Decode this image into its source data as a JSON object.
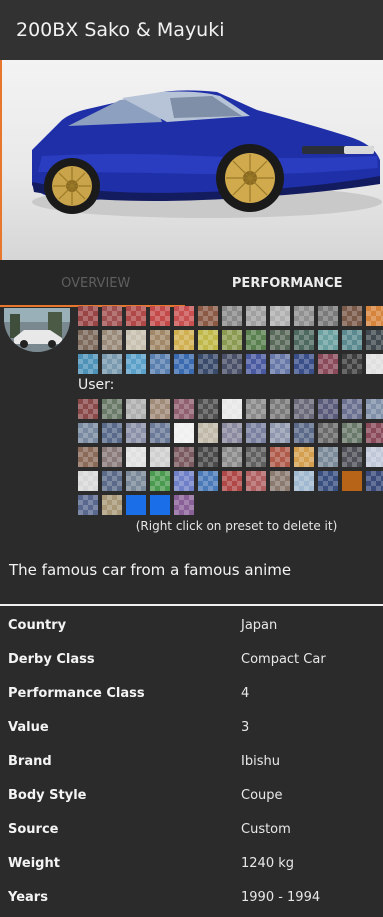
{
  "header": {
    "title": "200BX Sako & Mayuki"
  },
  "tabs": [
    {
      "label": "OVERVIEW",
      "active": false
    },
    {
      "label": "PERFORMANCE",
      "active": true
    }
  ],
  "accent": "#e8772e",
  "palette": {
    "preset_colors": [
      "#9a4545",
      "#a05050",
      "#b04848",
      "#c44a4a",
      "#c85050",
      "#8a5a45",
      "#8a8a8a",
      "#a0a0a0",
      "#b0b0b0",
      "#909090",
      "#7a7a7a",
      "#7a5a48",
      "#d6843c",
      "#7d6a5c",
      "#9a8a7a",
      "#c8c0b0",
      "#a08868",
      "#d0b050",
      "#c0b848",
      "#8a9a50",
      "#5a8050",
      "#5a6a5a",
      "#4e6a60",
      "#6aa0a0",
      "#5a8a90",
      "#404a50",
      "#4e92b8",
      "#7a9ab0",
      "#5aa0c8",
      "#5a80b0",
      "#3a6ab0",
      "#3a4a6a",
      "#4a5068",
      "#4a5aa0",
      "#6878a8",
      "#3a4e8a",
      "#8a4a5a",
      "#3e3e3e",
      "#e0e0e0"
    ],
    "user_label": "User:",
    "user_colors": [
      "#8a4a4a",
      "#6a7a68",
      "#b0b0b0",
      "#a08a78",
      "#906070",
      "#505050",
      "#e8e8e8",
      "#8a8a8a",
      "#7a7a7a",
      "#6a6a7a",
      "#5a5a7a",
      "#6a7090",
      "#8090a8",
      "#7a8aa0",
      "#5a6a8a",
      "#8a90a8",
      "#6a7a98",
      "#f0f0f0",
      "#c0b8a8",
      "#8a8aa0",
      "#7a80a0",
      "#9098b0",
      "#5a6a88",
      "#6a6a6a",
      "#6a7a6a",
      "#8a4a5a",
      "#8a6a58",
      "#8a7a7a",
      "#e0e0e0",
      "#d0d0d0",
      "#7a5a60",
      "#4a4a4a",
      "#8a8a8a",
      "#606060",
      "#b05a4a",
      "#d4a050",
      "#7a8a98",
      "#505058",
      "#c0c8d8",
      "#d8d8d8",
      "#5a6a88",
      "#7a8a9a",
      "#4a9a50",
      "#7080c8",
      "#4a7ab8",
      "#b04848",
      "#b06060",
      "#8a7a70",
      "#a0b8d0",
      "#3a5080",
      "#b86418",
      "#3a4a7a",
      "#5a6890",
      "#a89878",
      "#1a6ee8",
      "#1a6ee8",
      "#8a6098"
    ],
    "hint": "(Right click on preset to delete it)"
  },
  "description": "The famous car from a famous anime",
  "info": [
    {
      "label": "Country",
      "value": "Japan"
    },
    {
      "label": "Derby Class",
      "value": "Compact Car"
    },
    {
      "label": "Performance Class",
      "value": "4"
    },
    {
      "label": "Value",
      "value": "3"
    },
    {
      "label": "Brand",
      "value": "Ibishu"
    },
    {
      "label": "Body Style",
      "value": "Coupe"
    },
    {
      "label": "Source",
      "value": "Custom"
    },
    {
      "label": "Weight",
      "value": "1240 kg"
    },
    {
      "label": "Years",
      "value": "1990 - 1994"
    }
  ]
}
